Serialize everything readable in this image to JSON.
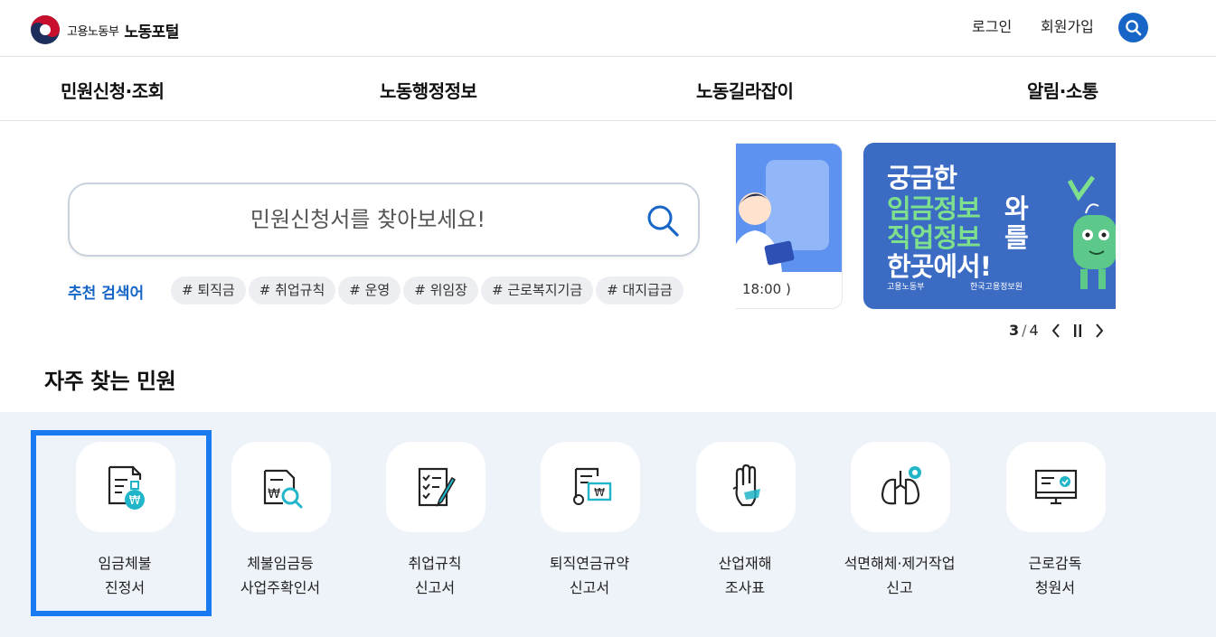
{
  "header": {
    "ministry": "고용노동부",
    "portal": "노동포털",
    "login": "로그인",
    "join": "회원가입"
  },
  "nav": [
    "민원신청·조회",
    "노동행정정보",
    "노동길라잡이",
    "알림·소통"
  ],
  "search": {
    "placeholder": "민원신청서를 찾아보세요!",
    "recommend_label": "추천 검색어",
    "tags": [
      "# 퇴직금",
      "# 취업규칙",
      "# 운영",
      "# 위임장",
      "# 근로복지기금",
      "# 대지급금"
    ]
  },
  "banner": {
    "prev_time": "18:00 )",
    "main_lines": [
      "궁금한",
      "임금정보",
      "와",
      "직업정보",
      "를",
      "한곳에서!"
    ],
    "footer_left": "고용노동부",
    "footer_right": "한국고용정보원",
    "pager": {
      "current": "3",
      "total": "4"
    }
  },
  "frequent": {
    "title": "자주 찾는 민원",
    "items": [
      {
        "line1": "임금체불",
        "line2": "진정서"
      },
      {
        "line1": "체불임금등",
        "line2": "사업주확인서"
      },
      {
        "line1": "취업규칙",
        "line2": "신고서"
      },
      {
        "line1": "퇴직연금규약",
        "line2": "신고서"
      },
      {
        "line1": "산업재해",
        "line2": "조사표"
      },
      {
        "line1": "석면해체·제거작업",
        "line2": "신고"
      },
      {
        "line1": "근로감독",
        "line2": "청원서"
      }
    ]
  },
  "colors": {
    "accent": "#1766c7",
    "highlight_border": "#1a7bf0",
    "section_bg": "#eef2f9",
    "banner_bg": "#3c6bc4",
    "banner_green": "#7ee08c",
    "icon_teal": "#20b5c8"
  },
  "icons": [
    "search-icon",
    "wage-document-icon",
    "document-magnifier-icon",
    "checklist-pen-icon",
    "pension-certificate-icon",
    "raised-hand-icon",
    "lungs-icon",
    "monitor-check-icon",
    "chevron-left-icon",
    "pause-icon",
    "chevron-right-icon"
  ]
}
